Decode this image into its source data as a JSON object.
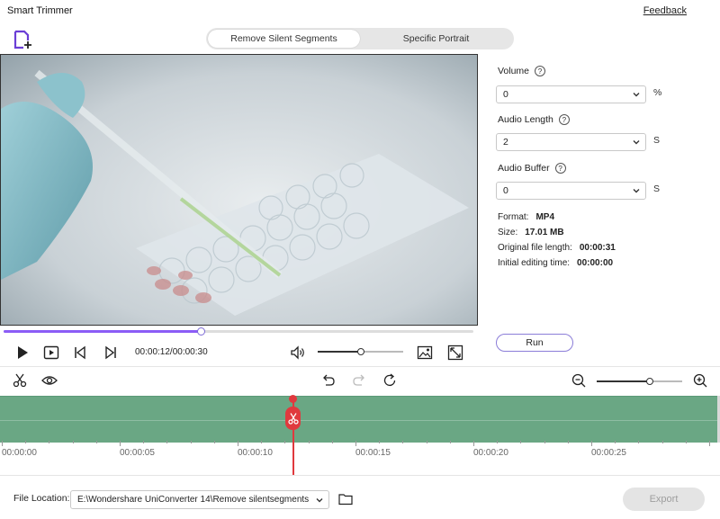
{
  "window": {
    "title": "Smart Trimmer",
    "feedback_label": "Feedback"
  },
  "tabs": [
    {
      "label": "Remove Silent Segments",
      "active": true
    },
    {
      "label": "Specific Portrait",
      "active": false
    }
  ],
  "player": {
    "time": "00:00:12/00:00:30",
    "progress_fraction": 0.42,
    "volume_fraction": 0.5
  },
  "settings": {
    "volume": {
      "label": "Volume",
      "value": "0",
      "unit": "%"
    },
    "audio_length": {
      "label": "Audio Length",
      "value": "2",
      "unit": "S"
    },
    "audio_buffer": {
      "label": "Audio Buffer",
      "value": "0",
      "unit": "S"
    }
  },
  "file_info": {
    "format_label": "Format:",
    "format_value": "MP4",
    "size_label": "Size:",
    "size_value": "17.01 MB",
    "orig_label": "Original file length:",
    "orig_value": "00:00:31",
    "init_label": "Initial editing time:",
    "init_value": "00:00:00"
  },
  "run_label": "Run",
  "timeline": {
    "zoom_fraction": 0.62,
    "ticks": [
      "00:00:00",
      "00:00:05",
      "00:00:10",
      "00:00:15",
      "00:00:20",
      "00:00:25"
    ]
  },
  "bottom": {
    "location_label": "File Location:",
    "location_value": "E:\\Wondershare UniConverter 14\\Remove silentsegments",
    "export_label": "Export"
  },
  "colors": {
    "accent": "#8b5cf6",
    "clip": "#6aa784",
    "playhead": "#e0393e"
  }
}
